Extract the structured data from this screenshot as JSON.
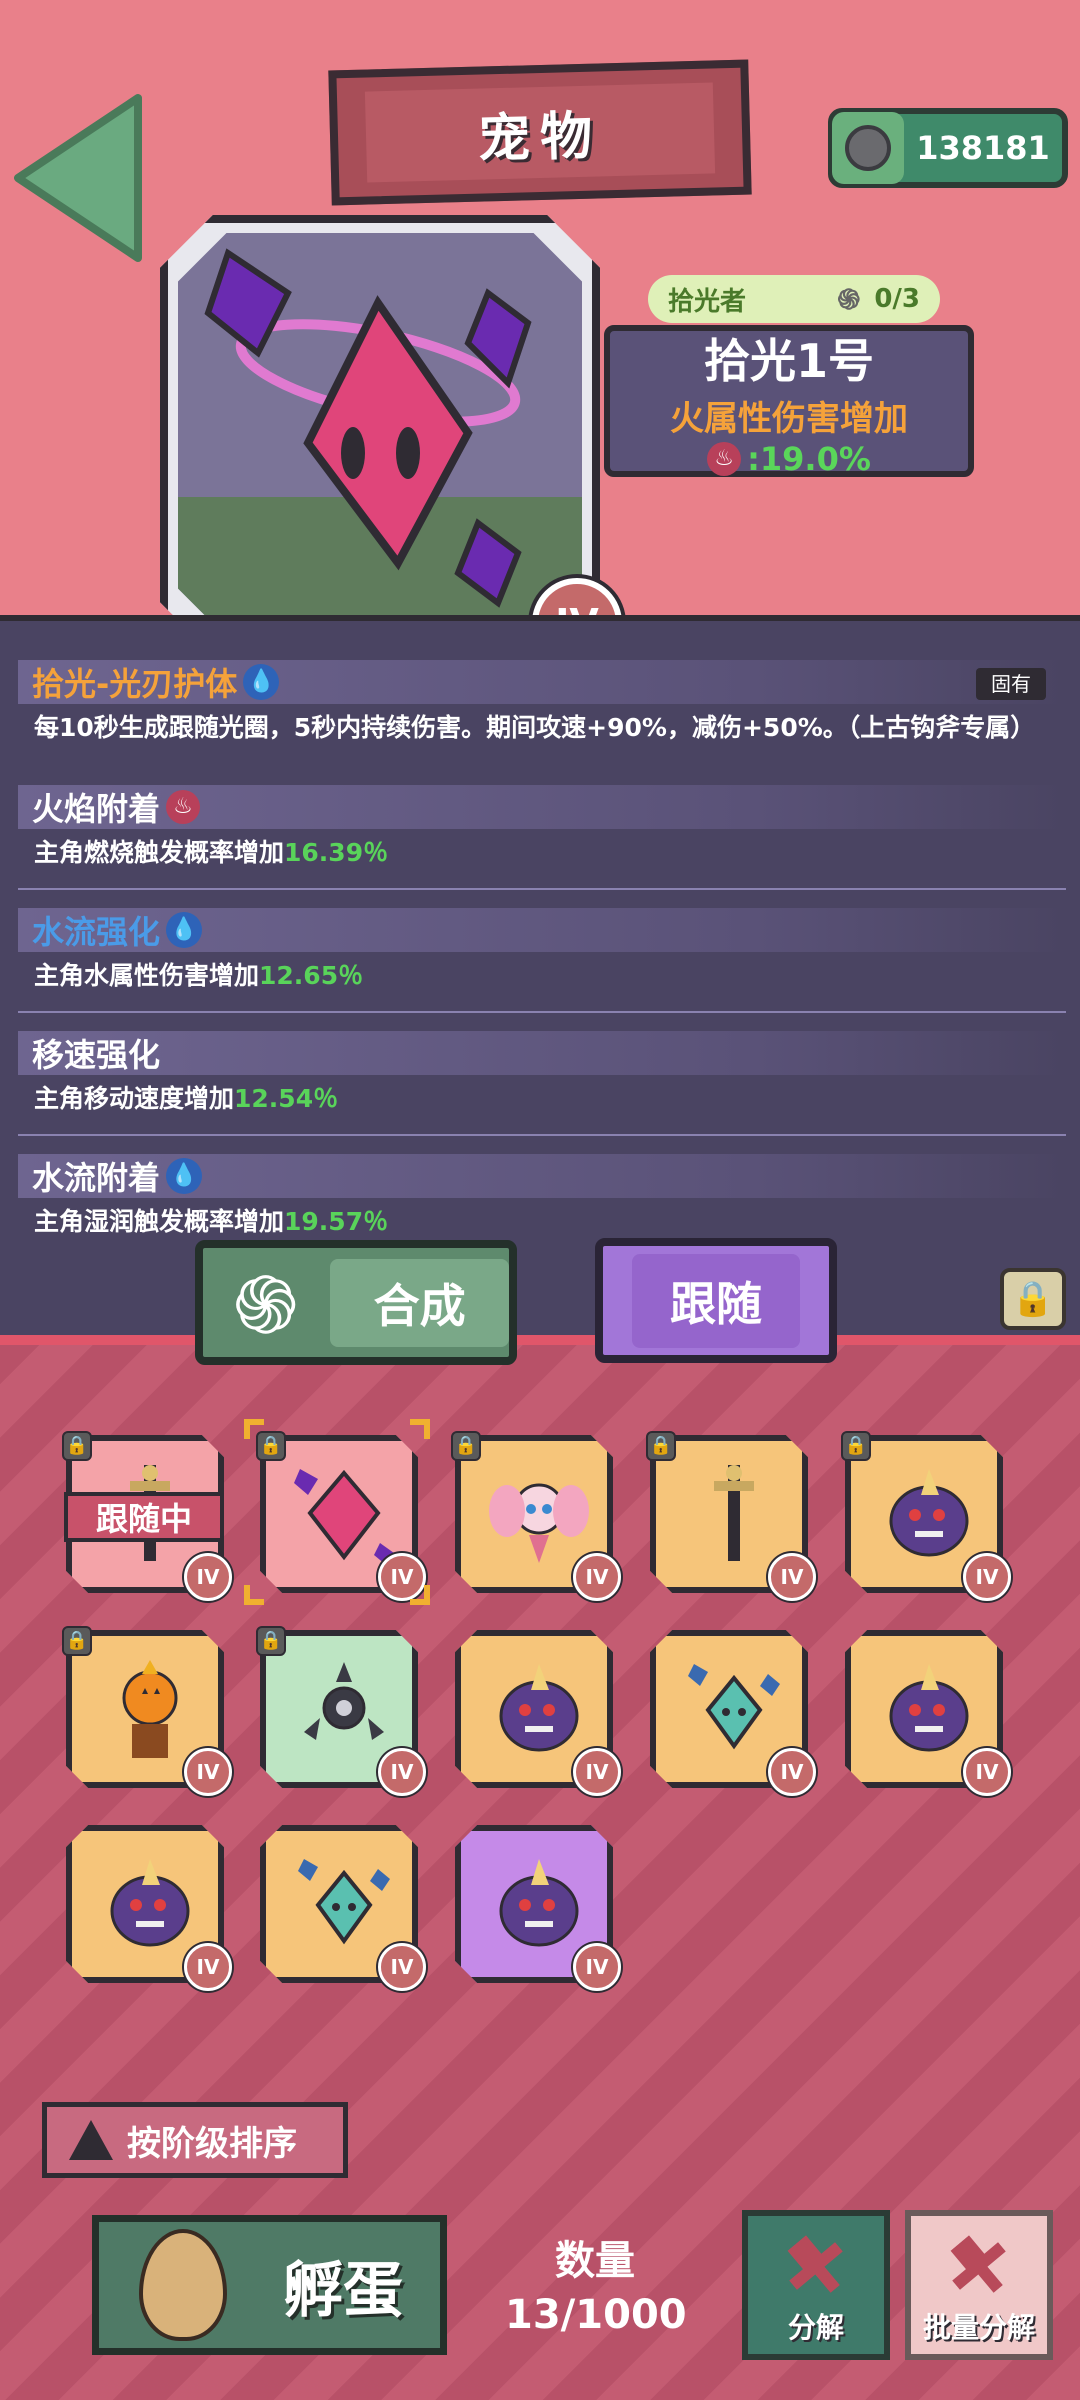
{
  "header": {
    "title": "宠物",
    "currency_value": "138181"
  },
  "pet": {
    "collector_label": "拾光者",
    "collector_progress": "0/3",
    "name": "拾光1号",
    "bonus_label": "火属性伤害增加",
    "bonus_value": ":19.0%",
    "tier": "IV"
  },
  "traits": [
    {
      "name": "拾光-光刃护体",
      "name_color": "#f5a23a",
      "element": "water",
      "tag": "固有",
      "desc_pre": "每10秒生成跟随光圈，5秒内持续伤害。期间攻速+90%，减伤+50%。（上古钩斧专属）",
      "desc_val": ""
    },
    {
      "name": "火焰附着",
      "name_color": "#ffffff",
      "element": "fire",
      "tag": "",
      "desc_pre": "主角燃烧触发概率增加",
      "desc_val": "16.39％"
    },
    {
      "name": "水流强化",
      "name_color": "#4a9be8",
      "element": "water",
      "tag": "",
      "desc_pre": "主角水属性伤害增加",
      "desc_val": "12.65％"
    },
    {
      "name": "移速强化",
      "name_color": "#ffffff",
      "element": "",
      "tag": "",
      "desc_pre": "主角移动速度增加",
      "desc_val": "12.54％"
    },
    {
      "name": "水流附着",
      "name_color": "#ffffff",
      "element": "water",
      "tag": "",
      "desc_pre": "主角湿润触发概率增加",
      "desc_val": "19.57％"
    }
  ],
  "actions": {
    "merge_label": "合成",
    "follow_label": "跟随"
  },
  "inventory": {
    "following_label": "跟随中",
    "tier": "IV",
    "items": [
      {
        "bg": "pink",
        "art": "sword",
        "locked": true
      },
      {
        "bg": "pink",
        "art": "crystal",
        "locked": true,
        "selected": true
      },
      {
        "bg": "orange",
        "art": "fairy",
        "locked": true
      },
      {
        "bg": "orange",
        "art": "sword",
        "locked": true
      },
      {
        "bg": "orange",
        "art": "blob",
        "locked": true
      },
      {
        "bg": "orange",
        "art": "pumpkin",
        "locked": true
      },
      {
        "bg": "green",
        "art": "drone",
        "locked": true
      },
      {
        "bg": "orange",
        "art": "blob",
        "locked": false
      },
      {
        "bg": "orange",
        "art": "teal-crystal",
        "locked": false
      },
      {
        "bg": "orange",
        "art": "blob",
        "locked": false
      },
      {
        "bg": "orange",
        "art": "blob",
        "locked": false
      },
      {
        "bg": "orange",
        "art": "teal-crystal",
        "locked": false
      },
      {
        "bg": "purple",
        "art": "blob",
        "locked": false
      }
    ]
  },
  "footer": {
    "sort_label": "按阶级排序",
    "hatch_label": "孵蛋",
    "count_label": "数量",
    "count_value": "13/1000",
    "decompose_label": "分解",
    "batch_decompose_label": "批量分解"
  },
  "colors": {
    "bonus_green": "#59d45a",
    "tier_badge": "#c46a6a",
    "panel": "#4a4462"
  }
}
